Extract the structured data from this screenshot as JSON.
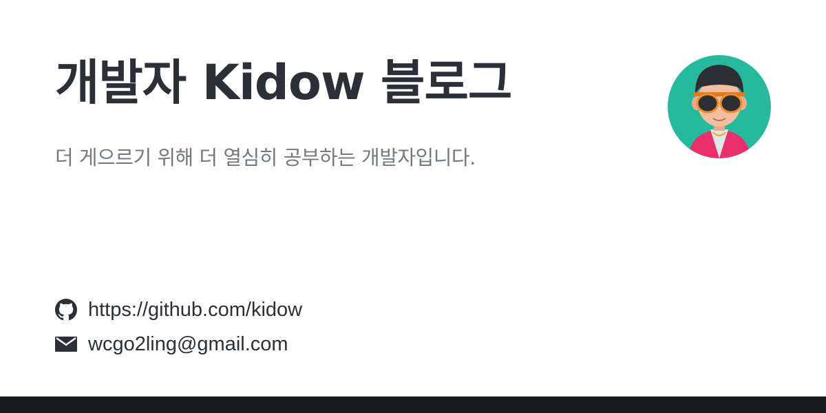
{
  "header": {
    "title": "개발자 Kidow 블로그",
    "subtitle": "더 게으르기 위해 더 열심히 공부하는 개발자입니다."
  },
  "links": {
    "github": {
      "icon": "github-icon",
      "text": "https://github.com/kidow"
    },
    "email": {
      "icon": "mail-icon",
      "text": "wcgo2ling@gmail.com"
    }
  },
  "colors": {
    "title": "#2b3038",
    "subtitle": "#737980",
    "avatar_bg": "#26b99d",
    "bottom_bar": "#1b1c1e"
  }
}
